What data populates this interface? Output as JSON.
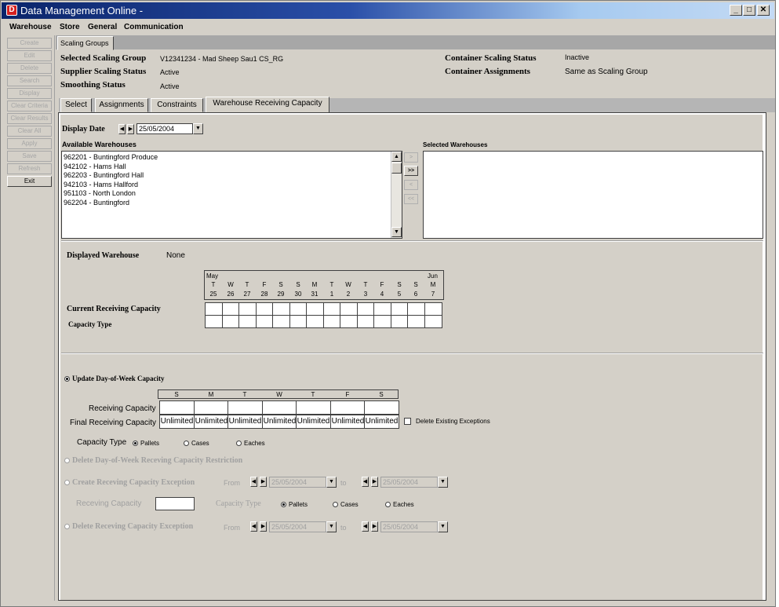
{
  "window": {
    "title": "Data Management Online -",
    "app_icon_letter": "D",
    "minimize": "_",
    "maximize": "□",
    "close": "✕"
  },
  "menu": [
    "Warehouse",
    "Store",
    "General",
    "Communication"
  ],
  "left_buttons": [
    {
      "label": "Create",
      "enabled": false
    },
    {
      "label": "Edit",
      "enabled": false
    },
    {
      "label": "Delete",
      "enabled": false
    },
    {
      "label": "Search",
      "enabled": false
    },
    {
      "label": "Display",
      "enabled": false
    },
    {
      "label": "Clear Criteria",
      "enabled": false
    },
    {
      "label": "Clear Results",
      "enabled": false
    },
    {
      "label": "Clear All",
      "enabled": false
    },
    {
      "label": "Apply",
      "enabled": false
    },
    {
      "label": "Save",
      "enabled": false
    },
    {
      "label": "Refresh",
      "enabled": false
    },
    {
      "label": "Exit",
      "enabled": true
    }
  ],
  "group_tab": "Scaling Groups",
  "header": {
    "selected_scaling_group_label": "Selected Scaling Group",
    "selected_scaling_group_value": "V12341234  - Mad Sheep Sau1 CS_RG",
    "supplier_scaling_status_label": "Supplier Scaling Status",
    "supplier_scaling_status_value": "Active",
    "smoothing_status_label": "Smoothing Status",
    "smoothing_status_value": "Active",
    "container_scaling_status_label": "Container Scaling Status",
    "container_scaling_status_value": "Inactive",
    "container_assignments_label": "Container Assignments",
    "container_assignments_value": "Same as Scaling Group"
  },
  "tabs": [
    "Select",
    "Assignments",
    "Constraints",
    "Warehouse Receiving Capacity"
  ],
  "active_tab": "Warehouse Receiving Capacity",
  "display_date": {
    "label": "Display Date",
    "value": "25/05/2004",
    "prev": "◀",
    "next": "▶",
    "dropdown": "▼"
  },
  "available_warehouses": {
    "label": "Available Warehouses",
    "items": [
      "962201 - Buntingford Produce",
      "942102 - Hams Hall",
      "962203 - Buntingford Hall",
      "942103 - Hams Hallford",
      "951103 - North London",
      "962204 - Buntingford"
    ],
    "scroll_up": "▲",
    "scroll_down": "▼"
  },
  "selected_warehouses": {
    "label": "Selected Warehouses",
    "items": []
  },
  "transfer_buttons": [
    {
      "label": ">",
      "enabled": false
    },
    {
      "label": ">>",
      "enabled": true
    },
    {
      "label": "<",
      "enabled": false
    },
    {
      "label": "<<",
      "enabled": false
    }
  ],
  "displayed_warehouse": {
    "label": "Displayed Warehouse",
    "value": "None"
  },
  "calendar": {
    "month_start": "May",
    "month_end": "Jun",
    "days": [
      {
        "dow": "T",
        "date": "25"
      },
      {
        "dow": "W",
        "date": "26"
      },
      {
        "dow": "T",
        "date": "27"
      },
      {
        "dow": "F",
        "date": "28"
      },
      {
        "dow": "S",
        "date": "29"
      },
      {
        "dow": "S",
        "date": "30"
      },
      {
        "dow": "M",
        "date": "31"
      },
      {
        "dow": "T",
        "date": "1"
      },
      {
        "dow": "W",
        "date": "2"
      },
      {
        "dow": "T",
        "date": "3"
      },
      {
        "dow": "F",
        "date": "4"
      },
      {
        "dow": "S",
        "date": "5"
      },
      {
        "dow": "S",
        "date": "6"
      },
      {
        "dow": "M",
        "date": "7"
      }
    ],
    "current_receiving_capacity_label": "Current Receiving Capacity",
    "capacity_type_label": "Capacity Type"
  },
  "update_dow": {
    "label": "Update Day-of-Week Capacity",
    "selected": true,
    "days": [
      "S",
      "M",
      "T",
      "W",
      "T",
      "F",
      "S"
    ],
    "receiving_capacity_label": "Receiving Capacity",
    "final_receiving_capacity_label": "Final Receiving Capacity",
    "final_values": [
      "Unlimited",
      "Unlimited",
      "Unlimited",
      "Unlimited",
      "Unlimited",
      "Unlimited",
      "Unlimited"
    ],
    "delete_existing_exceptions_label": "Delete Existing Exceptions",
    "capacity_type_label": "Capacity Type",
    "capacity_type_options": [
      "Pallets",
      "Cases",
      "Eaches"
    ],
    "capacity_type_selected": "Pallets"
  },
  "delete_dow": {
    "label": "Delete Day-of-Week Receving Capacity Restriction"
  },
  "create_exception": {
    "label": "Create Receving Capacity Exception",
    "from_label": "From",
    "from_value": "25/05/2004",
    "to_label": "to",
    "to_value": "25/05/2004",
    "receving_capacity_label": "Receving Capacity",
    "capacity_type_label": "Capacity Type",
    "capacity_type_options": [
      "Pallets",
      "Cases",
      "Eaches"
    ],
    "capacity_type_selected": "Pallets"
  },
  "delete_exception": {
    "label": "Delete Receving Capacity Exception",
    "from_label": "From",
    "from_value": "25/05/2004",
    "to_label": "to",
    "to_value": "25/05/2004"
  }
}
